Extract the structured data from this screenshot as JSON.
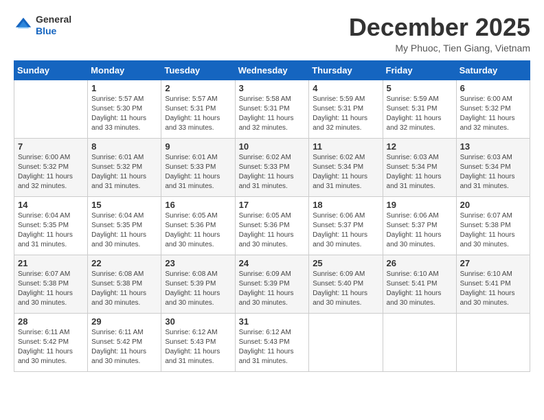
{
  "header": {
    "logo": {
      "general": "General",
      "blue": "Blue"
    },
    "title": "December 2025",
    "location": "My Phuoc, Tien Giang, Vietnam"
  },
  "calendar": {
    "weekdays": [
      "Sunday",
      "Monday",
      "Tuesday",
      "Wednesday",
      "Thursday",
      "Friday",
      "Saturday"
    ],
    "weeks": [
      [
        {
          "day": "",
          "info": ""
        },
        {
          "day": "1",
          "info": "Sunrise: 5:57 AM\nSunset: 5:30 PM\nDaylight: 11 hours\nand 33 minutes."
        },
        {
          "day": "2",
          "info": "Sunrise: 5:57 AM\nSunset: 5:31 PM\nDaylight: 11 hours\nand 33 minutes."
        },
        {
          "day": "3",
          "info": "Sunrise: 5:58 AM\nSunset: 5:31 PM\nDaylight: 11 hours\nand 32 minutes."
        },
        {
          "day": "4",
          "info": "Sunrise: 5:59 AM\nSunset: 5:31 PM\nDaylight: 11 hours\nand 32 minutes."
        },
        {
          "day": "5",
          "info": "Sunrise: 5:59 AM\nSunset: 5:31 PM\nDaylight: 11 hours\nand 32 minutes."
        },
        {
          "day": "6",
          "info": "Sunrise: 6:00 AM\nSunset: 5:32 PM\nDaylight: 11 hours\nand 32 minutes."
        }
      ],
      [
        {
          "day": "7",
          "info": "Sunrise: 6:00 AM\nSunset: 5:32 PM\nDaylight: 11 hours\nand 32 minutes."
        },
        {
          "day": "8",
          "info": "Sunrise: 6:01 AM\nSunset: 5:32 PM\nDaylight: 11 hours\nand 31 minutes."
        },
        {
          "day": "9",
          "info": "Sunrise: 6:01 AM\nSunset: 5:33 PM\nDaylight: 11 hours\nand 31 minutes."
        },
        {
          "day": "10",
          "info": "Sunrise: 6:02 AM\nSunset: 5:33 PM\nDaylight: 11 hours\nand 31 minutes."
        },
        {
          "day": "11",
          "info": "Sunrise: 6:02 AM\nSunset: 5:34 PM\nDaylight: 11 hours\nand 31 minutes."
        },
        {
          "day": "12",
          "info": "Sunrise: 6:03 AM\nSunset: 5:34 PM\nDaylight: 11 hours\nand 31 minutes."
        },
        {
          "day": "13",
          "info": "Sunrise: 6:03 AM\nSunset: 5:34 PM\nDaylight: 11 hours\nand 31 minutes."
        }
      ],
      [
        {
          "day": "14",
          "info": "Sunrise: 6:04 AM\nSunset: 5:35 PM\nDaylight: 11 hours\nand 31 minutes."
        },
        {
          "day": "15",
          "info": "Sunrise: 6:04 AM\nSunset: 5:35 PM\nDaylight: 11 hours\nand 30 minutes."
        },
        {
          "day": "16",
          "info": "Sunrise: 6:05 AM\nSunset: 5:36 PM\nDaylight: 11 hours\nand 30 minutes."
        },
        {
          "day": "17",
          "info": "Sunrise: 6:05 AM\nSunset: 5:36 PM\nDaylight: 11 hours\nand 30 minutes."
        },
        {
          "day": "18",
          "info": "Sunrise: 6:06 AM\nSunset: 5:37 PM\nDaylight: 11 hours\nand 30 minutes."
        },
        {
          "day": "19",
          "info": "Sunrise: 6:06 AM\nSunset: 5:37 PM\nDaylight: 11 hours\nand 30 minutes."
        },
        {
          "day": "20",
          "info": "Sunrise: 6:07 AM\nSunset: 5:38 PM\nDaylight: 11 hours\nand 30 minutes."
        }
      ],
      [
        {
          "day": "21",
          "info": "Sunrise: 6:07 AM\nSunset: 5:38 PM\nDaylight: 11 hours\nand 30 minutes."
        },
        {
          "day": "22",
          "info": "Sunrise: 6:08 AM\nSunset: 5:38 PM\nDaylight: 11 hours\nand 30 minutes."
        },
        {
          "day": "23",
          "info": "Sunrise: 6:08 AM\nSunset: 5:39 PM\nDaylight: 11 hours\nand 30 minutes."
        },
        {
          "day": "24",
          "info": "Sunrise: 6:09 AM\nSunset: 5:39 PM\nDaylight: 11 hours\nand 30 minutes."
        },
        {
          "day": "25",
          "info": "Sunrise: 6:09 AM\nSunset: 5:40 PM\nDaylight: 11 hours\nand 30 minutes."
        },
        {
          "day": "26",
          "info": "Sunrise: 6:10 AM\nSunset: 5:41 PM\nDaylight: 11 hours\nand 30 minutes."
        },
        {
          "day": "27",
          "info": "Sunrise: 6:10 AM\nSunset: 5:41 PM\nDaylight: 11 hours\nand 30 minutes."
        }
      ],
      [
        {
          "day": "28",
          "info": "Sunrise: 6:11 AM\nSunset: 5:42 PM\nDaylight: 11 hours\nand 30 minutes."
        },
        {
          "day": "29",
          "info": "Sunrise: 6:11 AM\nSunset: 5:42 PM\nDaylight: 11 hours\nand 30 minutes."
        },
        {
          "day": "30",
          "info": "Sunrise: 6:12 AM\nSunset: 5:43 PM\nDaylight: 11 hours\nand 31 minutes."
        },
        {
          "day": "31",
          "info": "Sunrise: 6:12 AM\nSunset: 5:43 PM\nDaylight: 11 hours\nand 31 minutes."
        },
        {
          "day": "",
          "info": ""
        },
        {
          "day": "",
          "info": ""
        },
        {
          "day": "",
          "info": ""
        }
      ]
    ]
  }
}
